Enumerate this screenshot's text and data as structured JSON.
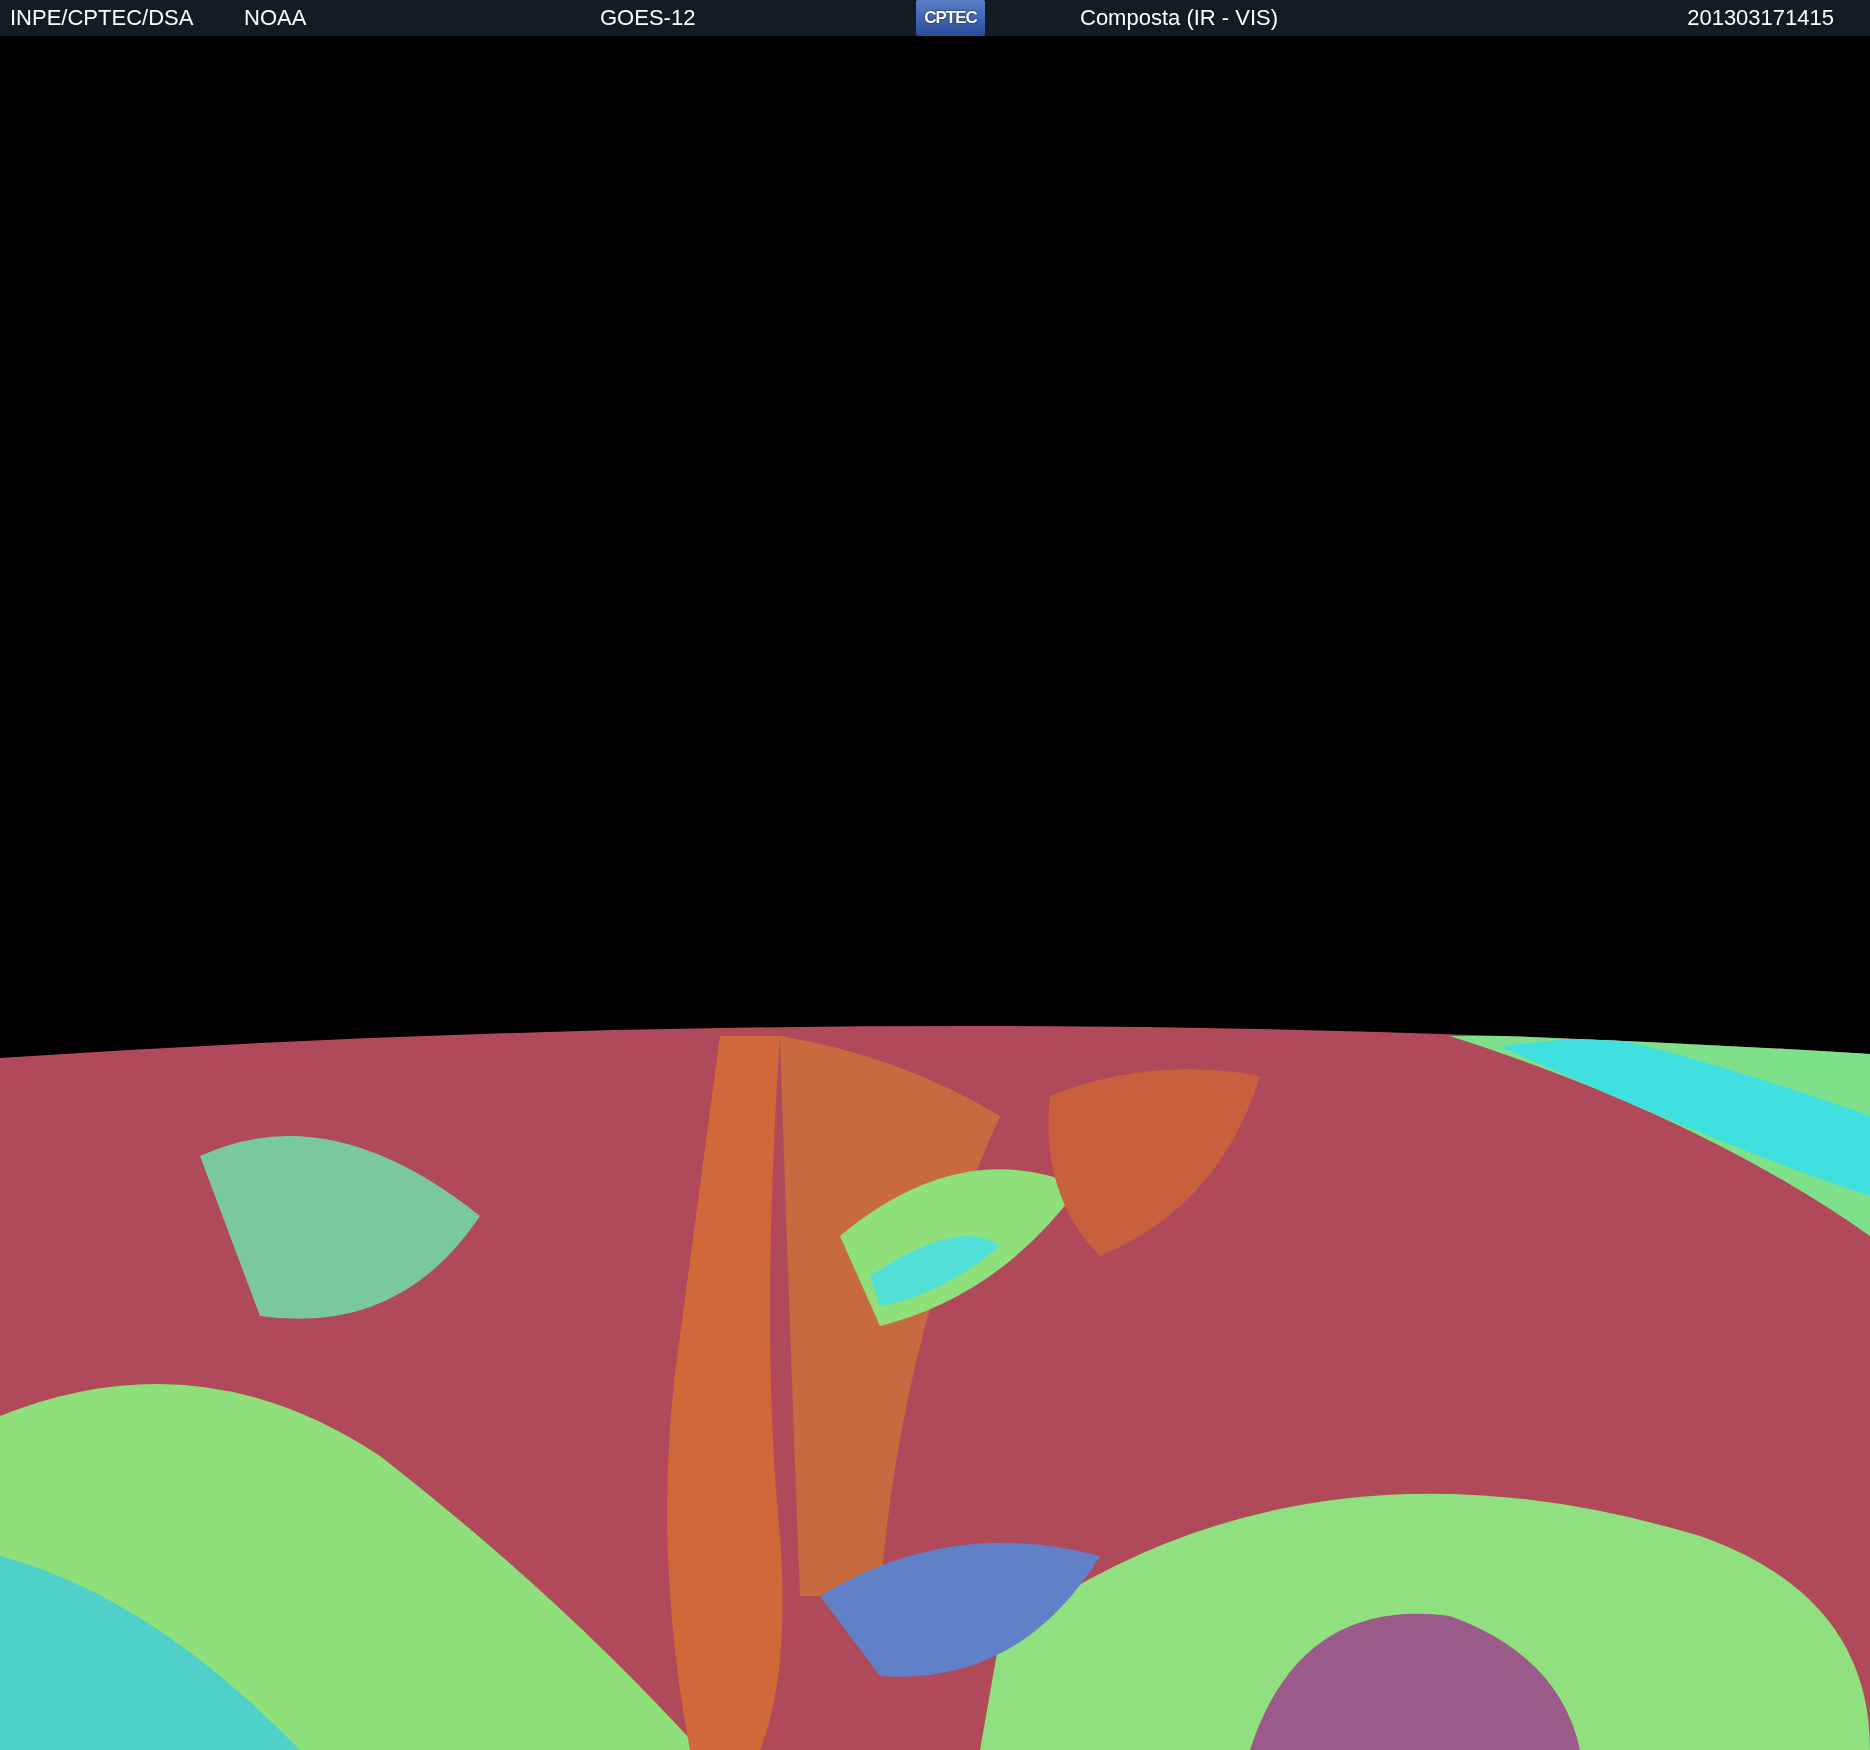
{
  "header": {
    "items": [
      {
        "kind": "text",
        "text": "INPE/CPTEC/DSA"
      },
      {
        "kind": "text",
        "text": "NOAA"
      },
      {
        "kind": "text",
        "text": "GOES-12"
      },
      {
        "kind": "logo",
        "text": "CPTEC"
      },
      {
        "kind": "text",
        "text": "Composta (IR - VIS)"
      },
      {
        "kind": "text",
        "text": "201303171415"
      }
    ]
  }
}
